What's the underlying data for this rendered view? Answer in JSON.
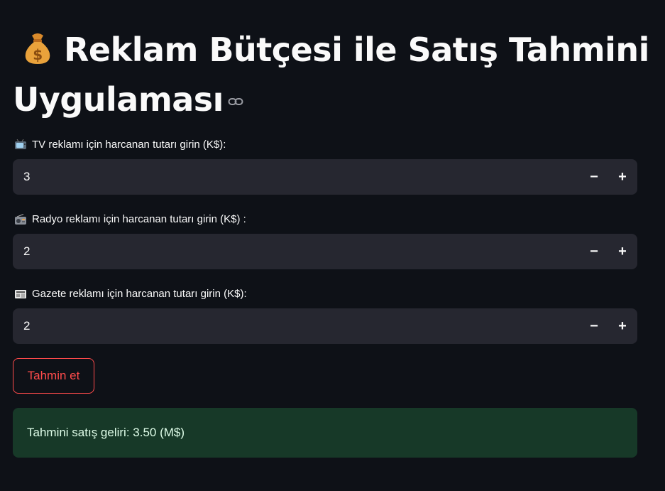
{
  "app": {
    "title_line": "Reklam Bütçesi ile Satış Tahmini Uygulaması",
    "title_icon": "money-bag-icon",
    "anchor_icon": "link-icon"
  },
  "colors": {
    "background": "#0e1117",
    "input_bg": "#262730",
    "accent": "#ff4b4b",
    "success_bg": "#173928",
    "success_text": "#dffde9",
    "text": "#fafafa"
  },
  "inputs": [
    {
      "icon": "television-icon",
      "label": "TV reklamı için harcanan tutarı girin (K$):",
      "value": "3",
      "minus": "−",
      "plus": "+"
    },
    {
      "icon": "radio-icon",
      "label": "Radyo reklamı için harcanan tutarı girin (K$) :",
      "value": "2",
      "minus": "−",
      "plus": "+"
    },
    {
      "icon": "newspaper-icon",
      "label": "Gazete reklamı için harcanan tutarı girin (K$):",
      "value": "2",
      "minus": "−",
      "plus": "+"
    }
  ],
  "predict_button": {
    "label": "Tahmin et"
  },
  "result": {
    "message": "Tahmini satış geliri: 3.50 (M$)"
  }
}
